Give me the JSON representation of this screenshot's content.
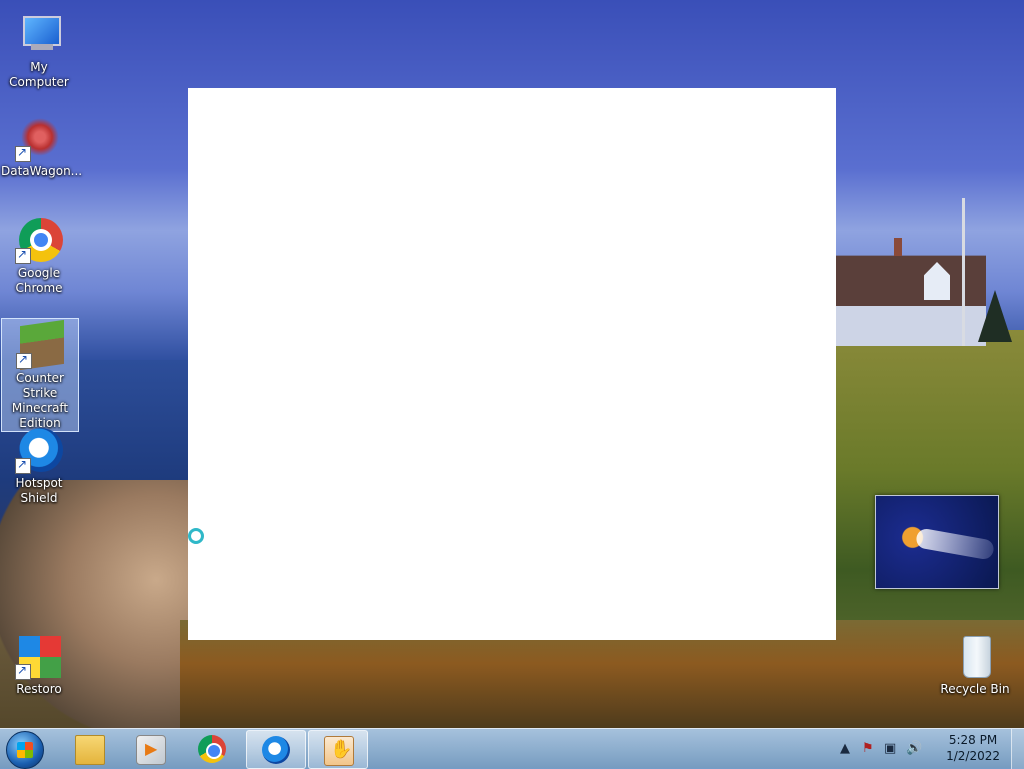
{
  "desktop": {
    "icons": [
      {
        "label": "My Computer",
        "icon": "computer-icon"
      },
      {
        "label": "DataWagon...",
        "icon": "datawagon-icon"
      },
      {
        "label": "Google Chrome",
        "icon": "chrome-icon"
      },
      {
        "label": "Counter Strike Minecraft Edition",
        "icon": "minecraft-icon"
      },
      {
        "label": "Hotspot Shield",
        "icon": "hotspot-shield-icon"
      },
      {
        "label": "Restoro",
        "icon": "restoro-icon"
      },
      {
        "label": "Recycle Bin",
        "icon": "recycle-bin-icon"
      }
    ]
  },
  "taskbar": {
    "buttons": [
      {
        "icon": "windows-explorer-icon"
      },
      {
        "icon": "media-player-icon"
      },
      {
        "icon": "chrome-icon"
      },
      {
        "icon": "hotspot-shield-icon",
        "active": true
      },
      {
        "icon": "installer-icon",
        "active": true
      }
    ],
    "tray_icons": [
      "show-hidden-icons-icon",
      "action-center-flag-icon",
      "network-icon",
      "volume-icon"
    ]
  },
  "clock": {
    "time": "5:28 PM",
    "date": "1/2/2022"
  }
}
